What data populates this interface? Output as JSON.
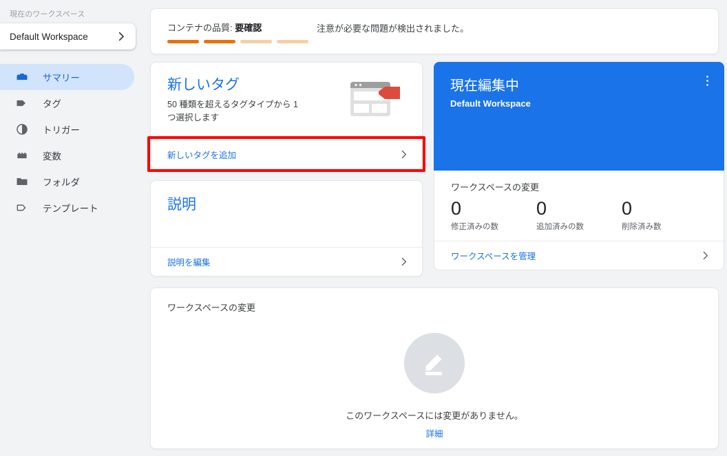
{
  "sidebar": {
    "workspace_label": "現在のワークスペース",
    "workspace_name": "Default Workspace",
    "items": [
      {
        "label": "サマリー",
        "icon": "container-icon",
        "active": true
      },
      {
        "label": "タグ",
        "icon": "tag-icon",
        "active": false
      },
      {
        "label": "トリガー",
        "icon": "trigger-icon",
        "active": false
      },
      {
        "label": "変数",
        "icon": "variable-icon",
        "active": false
      },
      {
        "label": "フォルダ",
        "icon": "folder-icon",
        "active": false
      },
      {
        "label": "テンプレート",
        "icon": "template-icon",
        "active": false
      }
    ]
  },
  "quality": {
    "title_prefix": "コンテナの品質: ",
    "title_status": "要確認",
    "message": "注意が必要な問題が検出されました。",
    "bars": [
      "#e8710a",
      "#e8710a",
      "#f6cfa6",
      "#f6cfa6"
    ]
  },
  "new_tag_card": {
    "title": "新しいタグ",
    "subtitle": "50 種類を超えるタグタイプから 1 つ選択します",
    "action_label": "新しいタグを追加",
    "illustration": "browser-tag-illustration",
    "highlighted": true,
    "highlight_color": "#ff0000"
  },
  "description_card": {
    "title": "説明",
    "action_label": "説明を編集"
  },
  "workspace_card": {
    "title": "現在編集中",
    "subtitle": "Default Workspace",
    "accent_color": "#1a73e8",
    "menu_icon": "more-vert-icon"
  },
  "workspace_changes": {
    "title": "ワークスペースの変更",
    "stats": [
      {
        "value": "0",
        "caption": "修正済みの数"
      },
      {
        "value": "0",
        "caption": "追加済みの数"
      },
      {
        "value": "0",
        "caption": "削除済み数"
      }
    ],
    "action_label": "ワークスペースを管理"
  },
  "changes_panel": {
    "title": "ワークスペースの変更",
    "empty_icon": "edit-pencil-icon",
    "empty_message": "このワークスペースには変更がありません。",
    "empty_link": "詳細"
  }
}
